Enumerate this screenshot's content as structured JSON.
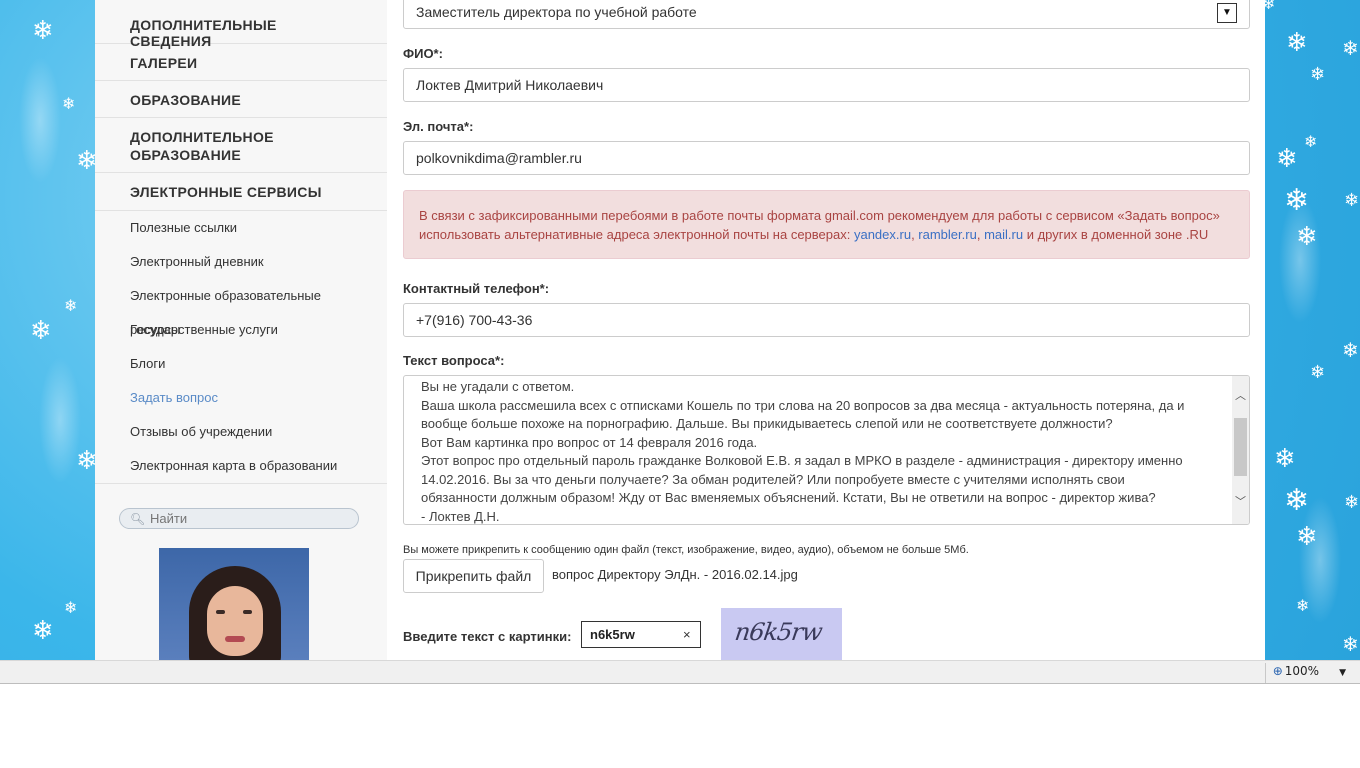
{
  "sidebar": {
    "main_items": [
      {
        "label": "ДОПОЛНИТЕЛЬНЫЕ СВЕДЕНИЯ"
      },
      {
        "label": "ГАЛЕРЕИ"
      },
      {
        "label": "ОБРАЗОВАНИЕ"
      },
      {
        "label": "ДОПОЛНИТЕЛЬНОЕ ОБРАЗОВАНИЕ"
      },
      {
        "label": "ЭЛЕКТРОННЫЕ СЕРВИСЫ"
      }
    ],
    "sub_items": [
      {
        "label": "Полезные ссылки"
      },
      {
        "label": "Электронный дневник"
      },
      {
        "label": "Электронные образовательные ресурсы"
      },
      {
        "label": "Государственные услуги"
      },
      {
        "label": "Блоги"
      },
      {
        "label": "Задать вопрос"
      },
      {
        "label": "Отзывы об учреждении"
      },
      {
        "label": "Электронная карта в образовании"
      }
    ],
    "search_placeholder": "Найти"
  },
  "form": {
    "recipient_value": "Заместитель директора по учебной работе",
    "name_label": "ФИО*:",
    "name_value": "Локтев Дмитрий Николаевич",
    "email_label": "Эл. почта*:",
    "email_value": "polkovnikdima@rambler.ru",
    "alert": {
      "text_before": "В связи с зафиксированными перебоями в работе почты формата gmail.com рекомендуем для работы с сервисом «Задать вопрос» использовать альтернативные адреса электронной почты на серверах: ",
      "link1": "yandex.ru",
      "link2": "rambler.ru",
      "link3": "mail.ru",
      "text_after": " и других в доменной зоне .RU"
    },
    "phone_label": "Контактный телефон*:",
    "phone_value": "+7(916) 700-43-36",
    "question_label": "Текст вопроса*:",
    "question_lines": [
      "Вы не угадали с ответом.",
      "Ваша школа рассмешила всех с отписками Кошель по три слова на 20 вопросов за два месяца - актуальность потеряна, да и",
      "вообще больше похоже на порнографию.   Дальше. Вы прикидываетесь слепой или не соответствуете должности?",
      "Вот Вам картинка про вопрос от 14 февраля 2016 года.",
      "Этот вопрос про отдельный  пароль  гражданке Волковой Е.В. я задал в МРКО в разделе - администрация - директору именно",
      "14.02.2016.    Вы за что деньги получаете? За обман родителей? Или попробуете вместе с учителями исполнять свои",
      "обязанности должным образом!  Жду от Вас вменяемых объяснений. Кстати, Вы не ответили на вопрос - директор жива?",
      "- Локтев Д.Н."
    ],
    "attach_hint": "Вы можете прикрепить к сообщению один файл (текст, изображение, видео, аудио), объемом не больше 5Мб.",
    "attach_button": "Прикрепить файл",
    "attached_file": "вопрос Директору ЭлДн. - 2016.02.14.jpg",
    "captcha_label": "Введите текст с картинки:",
    "captcha_value": "n6k5rw",
    "captcha_clear": "×",
    "captcha_image_text": "n6k5rw"
  },
  "statusbar": {
    "zoom": "100%"
  },
  "colors": {
    "background": "#2aa3dc",
    "link": "#3a6fc4",
    "alert_bg": "#f2dede",
    "alert_text": "#a94442",
    "active_nav": "#5a8bc7"
  }
}
